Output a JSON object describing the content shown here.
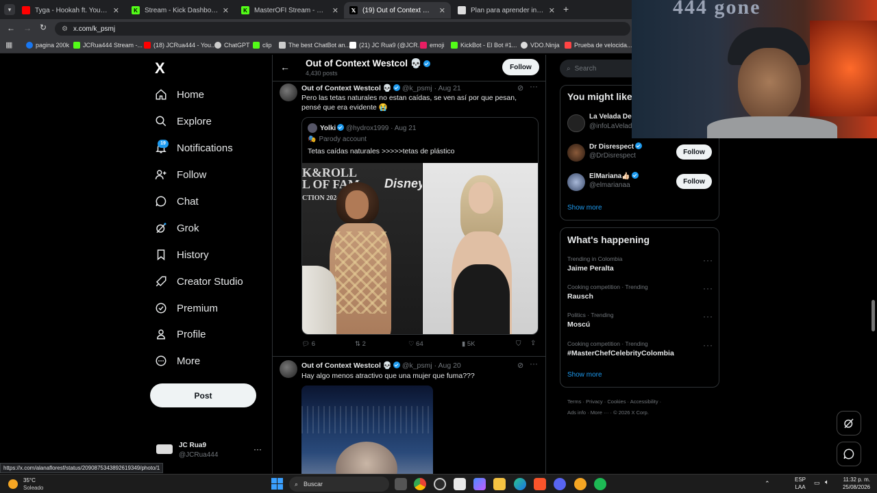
{
  "browser": {
    "tabs": [
      {
        "label": "Tyga - Hookah ft. Young Thug",
        "icon_color": "#ff0000",
        "active": false
      },
      {
        "label": "Stream - Kick Dashboard",
        "icon_color": "#53fc18",
        "active": false
      },
      {
        "label": "MasterOFI Stream - Watch Live",
        "icon_color": "#53fc18",
        "active": false
      },
      {
        "label": "(19) Out of Context Westcol 💀",
        "icon_color": "#ffffff",
        "active": true
      },
      {
        "label": "Plan para aprender inglés",
        "icon_color": "#dddddd",
        "active": false
      }
    ],
    "new_tab": "+",
    "url": "x.com/k_psmj",
    "bookmarks": [
      {
        "label": "pagina 200k",
        "color": "#1877f2"
      },
      {
        "label": "JCRua444 Stream -...",
        "color": "#53fc18"
      },
      {
        "label": "(18) JCRua444 - You...",
        "color": "#ff0000"
      },
      {
        "label": "ChatGPT",
        "color": "#cccccc"
      },
      {
        "label": "clip",
        "color": "#53fc18"
      },
      {
        "label": "The best ChatBot an...",
        "color": "#cccccc"
      },
      {
        "label": "(21) JC Rua9 (@JCR...",
        "color": "#ffffff"
      },
      {
        "label": "emoji",
        "color": "#e91e63"
      },
      {
        "label": "KickBot - El Bot #1...",
        "color": "#53fc18"
      },
      {
        "label": "VDO.Ninja",
        "color": "#dddddd"
      },
      {
        "label": "Prueba de velocida...",
        "color": "#ff4444"
      }
    ]
  },
  "nav": {
    "logo": "X",
    "items": [
      {
        "label": "Home",
        "icon": "home-icon"
      },
      {
        "label": "Explore",
        "icon": "search-icon"
      },
      {
        "label": "Notifications",
        "icon": "bell-icon",
        "badge": "19"
      },
      {
        "label": "Follow",
        "icon": "person-add-icon"
      },
      {
        "label": "Chat",
        "icon": "chat-icon"
      },
      {
        "label": "Grok",
        "icon": "grok-icon"
      },
      {
        "label": "History",
        "icon": "bookmark-icon"
      },
      {
        "label": "Creator Studio",
        "icon": "rocket-icon"
      },
      {
        "label": "Premium",
        "icon": "premium-icon"
      },
      {
        "label": "Profile",
        "icon": "person-icon"
      },
      {
        "label": "More",
        "icon": "more-circle-icon"
      }
    ],
    "post_label": "Post",
    "account": {
      "name": "JC Rua9",
      "handle": "@JCRua444"
    }
  },
  "profile_header": {
    "name": "Out of Context Westcol 💀",
    "posts": "4,430 posts",
    "follow_label": "Follow"
  },
  "tweets": [
    {
      "author": "Out of Context Westcol 💀",
      "handle": "@k_psmj",
      "date": "· Aug 21",
      "text": "Pero las tetas naturales no estan caídas, se ven así  por que pesan,  pensé que era evidente 😭",
      "quote": {
        "author": "Yolki",
        "handle": "@hydrox1999",
        "date": "· Aug 21",
        "parody": "Parody account",
        "text": "Tetas caídas naturales >>>>>tetas de plástico"
      },
      "stats": {
        "replies": "6",
        "reposts": "2",
        "likes": "64",
        "views": "5K"
      }
    },
    {
      "author": "Out of Context Westcol 💀",
      "handle": "@k_psmj",
      "date": "· Aug 20",
      "text": "Hay algo menos atractivo que una mujer que fuma???"
    }
  ],
  "right": {
    "search_placeholder": "Search",
    "might_like_title": "You might like",
    "suggestions": [
      {
        "name": "La Velada De",
        "handle": "@infoLaVelad"
      },
      {
        "name": "Dr Disrespect",
        "handle": "@DrDisrespect",
        "follow": "Follow"
      },
      {
        "name": "ElMariana👍🏻",
        "handle": "@elmarianaa",
        "follow": "Follow"
      }
    ],
    "show_more": "Show more",
    "happening_title": "What's happening",
    "trends": [
      {
        "category": "Trending in Colombia",
        "name": "Jaime Peralta"
      },
      {
        "category": "Cooking competition · Trending",
        "name": "Rausch"
      },
      {
        "category": "Politics · Trending",
        "name": "Moscú"
      },
      {
        "category": "Cooking competition · Trending",
        "name": "#MasterChefCelebrityColombia"
      }
    ],
    "footer": [
      "Terms",
      "Privacy",
      "Cookies",
      "Accessibility",
      "Ads info",
      "More ···",
      "© 2026 X Corp."
    ]
  },
  "status_url": "https://x.com/alanafloresf/status/2090875343892619349/photo/1",
  "taskbar": {
    "weather_temp": "35°C",
    "weather_desc": "Soleado",
    "search_label": "Buscar",
    "lang_top": "ESP",
    "lang_bottom": "LAA",
    "time": "11:32 p. m.",
    "date": "25/08/2026"
  },
  "webcam": {
    "poster_text": "444 gone"
  }
}
